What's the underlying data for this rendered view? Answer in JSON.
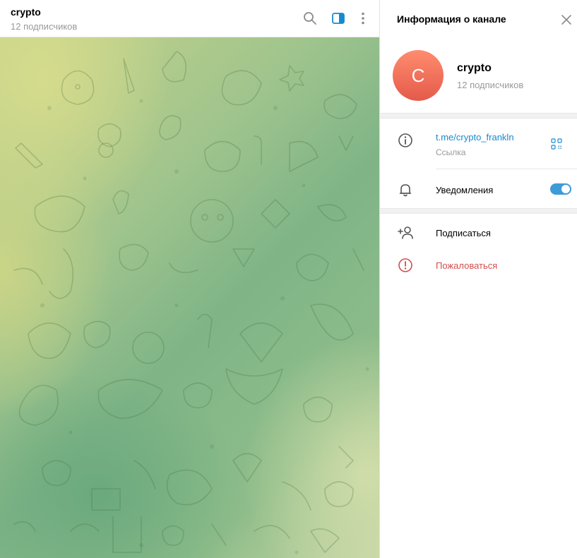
{
  "chat": {
    "title": "crypto",
    "subscribers": "12 подписчиков",
    "icons": [
      "search-icon",
      "sidebar-toggle-icon",
      "more-vertical-icon"
    ]
  },
  "panel": {
    "title": "Информация о канале",
    "avatar_letter": "C",
    "channel_name": "crypto",
    "subscribers": "12 подписчиков",
    "link": "t.me/crypto_frankln",
    "link_label": "Ссылка",
    "notifications_label": "Уведомления",
    "notifications_on": true,
    "subscribe_label": "Подписаться",
    "report_label": "Пожаловаться"
  },
  "colors": {
    "accent": "#168acd",
    "toggle": "#3d9bd8",
    "report": "#d14e4e",
    "avatar_top": "#ff8c6e",
    "avatar_bottom": "#e45a4b"
  }
}
